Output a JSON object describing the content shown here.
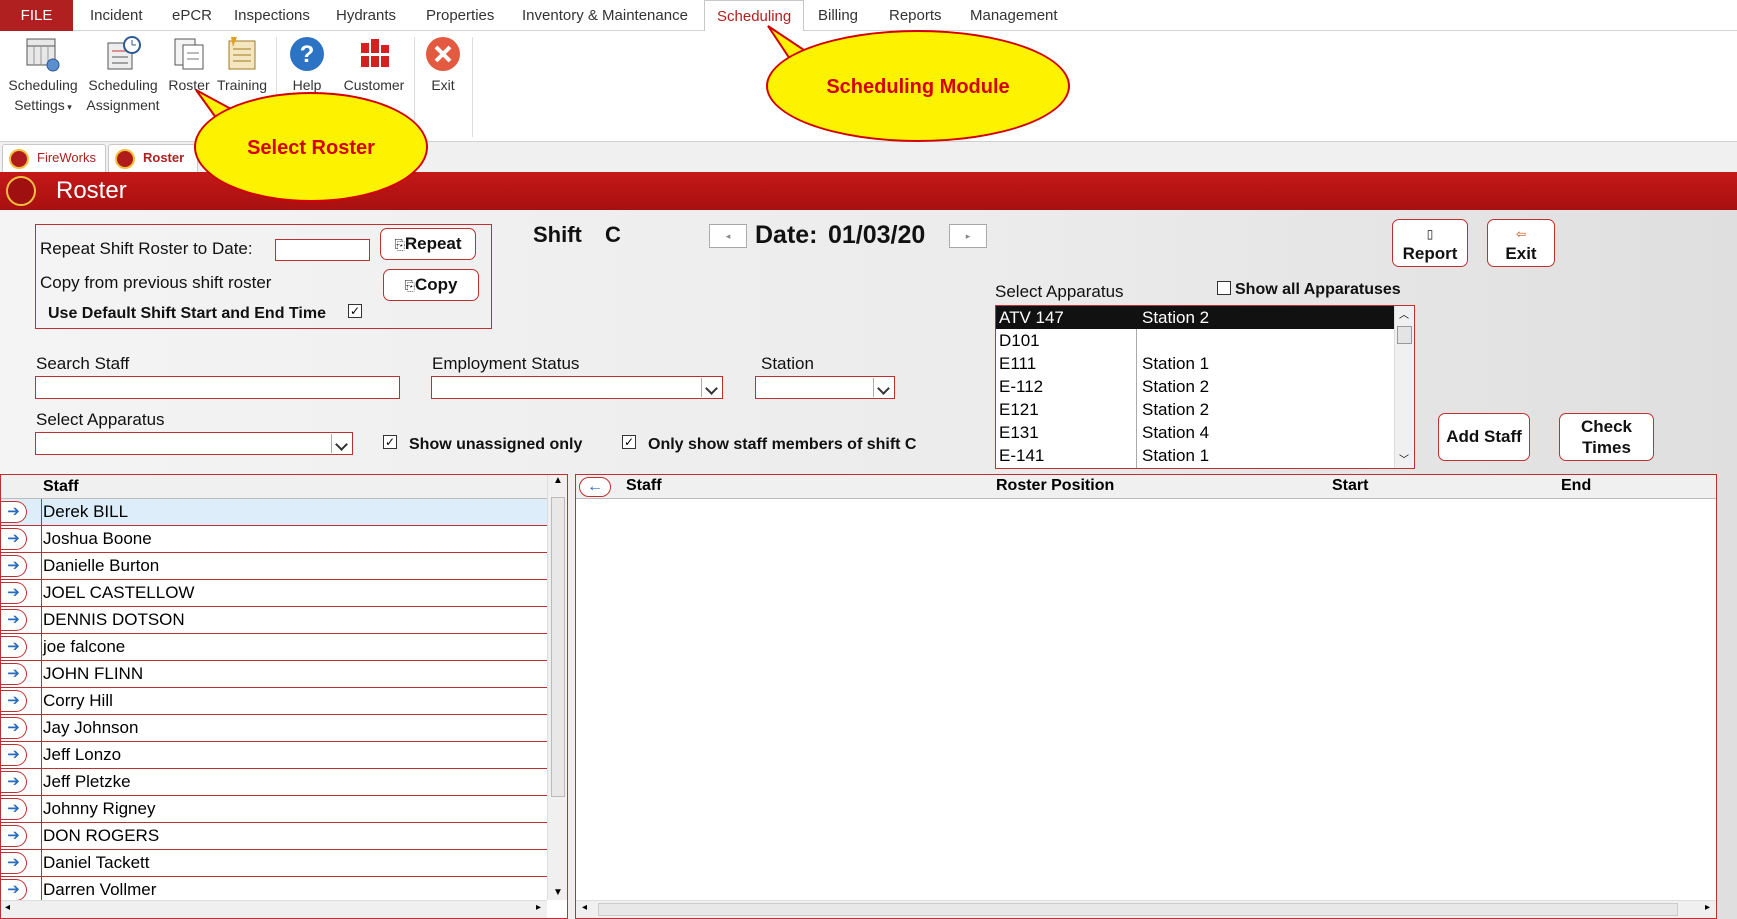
{
  "menu": {
    "file": "FILE",
    "tabs": [
      "Incident",
      "ePCR",
      "Inspections",
      "Hydrants",
      "Properties",
      "Inventory & Maintenance",
      "Scheduling",
      "Billing",
      "Reports",
      "Management"
    ],
    "active_tab": "Scheduling"
  },
  "ribbon": {
    "scheduling_settings_1": "Scheduling",
    "scheduling_settings_2": "Settings",
    "scheduling_assignment_1": "Scheduling",
    "scheduling_assignment_2": "Assignment",
    "roster": "Roster",
    "training": "Training",
    "help": "Help",
    "customer": "Customer",
    "exit": "Exit"
  },
  "doc_tabs": [
    "FireWorks",
    "Roster"
  ],
  "form_title": "Roster",
  "repeat": {
    "repeat_label": "Repeat Shift Roster to Date:",
    "repeat_value": "",
    "repeat_button": "Repeat",
    "copy_label": "Copy from previous shift roster",
    "copy_button": "Copy",
    "default_time_label": "Use Default Shift Start and End Time",
    "default_time_checked": true
  },
  "shift": {
    "label": "Shift",
    "value": "C"
  },
  "date": {
    "label": "Date:",
    "value": "01/03/20"
  },
  "actions": {
    "report": "Report",
    "exit": "Exit",
    "add_staff": "Add Staff",
    "check_times_1": "Check",
    "check_times_2": "Times"
  },
  "filters": {
    "search_staff_label": "Search Staff",
    "search_staff_value": "",
    "employment_status_label": "Employment Status",
    "employment_status_value": "",
    "station_label": "Station",
    "station_value": "",
    "select_apparatus_label": "Select Apparatus",
    "select_apparatus_value": "",
    "show_unassigned_label": "Show unassigned only",
    "show_unassigned_checked": true,
    "only_shift_label": "Only show staff members of shift C",
    "only_shift_checked": true
  },
  "apparatus_panel": {
    "label": "Select Apparatus",
    "show_all_label": "Show all Apparatuses",
    "show_all_checked": false,
    "rows": [
      {
        "unit": "ATV 147",
        "station": "Station 2"
      },
      {
        "unit": "D101",
        "station": ""
      },
      {
        "unit": "E111",
        "station": "Station 1"
      },
      {
        "unit": "E-112",
        "station": "Station 2"
      },
      {
        "unit": "E121",
        "station": "Station 2"
      },
      {
        "unit": "E131",
        "station": "Station 4"
      },
      {
        "unit": "E-141",
        "station": "Station 1"
      }
    ],
    "selected_index": 0
  },
  "staff_list": {
    "header": "Staff",
    "rows": [
      "Derek BILL",
      "Joshua Boone",
      "Danielle Burton",
      "JOEL CASTELLOW",
      "DENNIS DOTSON",
      "joe falcone",
      "JOHN FLINN",
      "Corry Hill",
      "Jay Johnson",
      "Jeff Lonzo",
      "Jeff Pletzke",
      "Johnny Rigney",
      "DON ROGERS",
      "Daniel Tackett",
      "Darren Vollmer"
    ],
    "selected_index": 0
  },
  "roster_grid": {
    "columns": [
      "Staff",
      "Roster Position",
      "Start",
      "End"
    ],
    "rows": []
  },
  "callouts": {
    "scheduling_module": "Scheduling Module",
    "select_roster": "Select Roster"
  },
  "colors": {
    "brand_red": "#b02020",
    "callout_yellow": "#fdf200",
    "callout_text": "#d40000"
  }
}
